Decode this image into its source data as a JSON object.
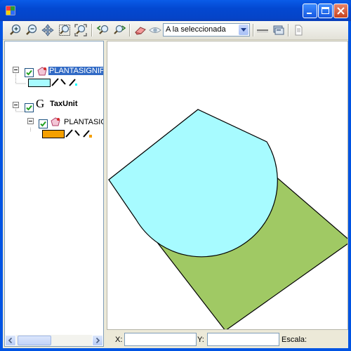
{
  "window": {
    "title": "",
    "icon": "app-window-icon",
    "buttons": [
      "minimize-icon",
      "maximize-icon",
      "close-icon"
    ]
  },
  "toolbar": {
    "tools": [
      "zoom-in-icon",
      "zoom-out-icon",
      "pan-icon",
      "zoom-window-icon",
      "zoom-extent-icon",
      "zoom-previous-icon",
      "zoom-next-icon",
      "eraser-icon",
      "visibility-eye-icon"
    ],
    "zoom_select": {
      "value": "A la seleccionada"
    },
    "right_tools": [
      "line-style-icon",
      "layer-properties-icon",
      "document-icon"
    ]
  },
  "tree": {
    "items": [
      {
        "label": "PLANTASIGNIF",
        "selected": true,
        "checked": true,
        "expanded": true,
        "icon": "polygon-layer-icon",
        "symbol": {
          "fill": "#a7fbff",
          "marker": "#00ffff"
        }
      },
      {
        "label": "TaxUnit",
        "bold": true,
        "checked": true,
        "expanded": true,
        "icon": "group-g-icon",
        "children": [
          {
            "label": "PLANTASIGNIF",
            "checked": true,
            "icon": "polygon-layer-icon",
            "symbol": {
              "fill": "#f5a000",
              "marker": "#f5a000"
            }
          }
        ]
      }
    ]
  },
  "map": {
    "polygon_fill": "#a0c964",
    "selection_fill": "#a7fbff",
    "outline": "#000000"
  },
  "status": {
    "x_label": "X:",
    "x_value": "",
    "y_label": "Y:",
    "y_value": "",
    "scale_label": "Escala:",
    "scale_value": ""
  },
  "colors": {
    "titlebar": "#0348d1",
    "selection": "#316ac5",
    "panel_border": "#7f9db9"
  }
}
